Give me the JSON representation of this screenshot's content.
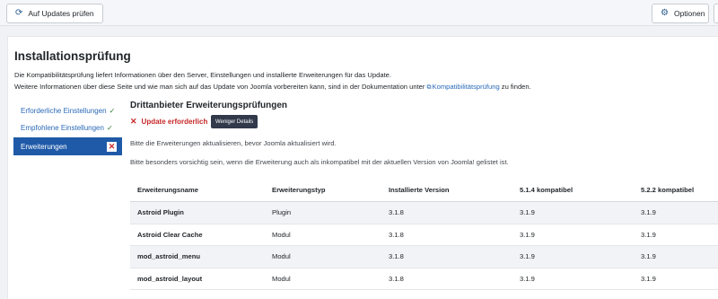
{
  "toolbar": {
    "updates_label": "Auf Updates prüfen",
    "options_label": "Optionen",
    "updates_icon": "refresh-icon",
    "options_icon": "gear-icon"
  },
  "page": {
    "title": "Installationsprüfung",
    "intro_line1": "Die Kompatibilitätsprüfung liefert Informationen über den Server, Einstellungen und installierte Erweiterungen für das Update.",
    "intro_line2_before": "Weitere Informationen über diese Seite und wie man sich auf das Update von Joomla vorbereiten kann, sind in der Dokumentation unter ",
    "intro_link": "Kompatibilitätsprüfung",
    "intro_line2_after": " zu finden."
  },
  "nav": {
    "items": [
      {
        "label": "Erforderliche Einstellungen",
        "mark": "✓"
      },
      {
        "label": "Empfohlene Einstellungen",
        "mark": "✓"
      },
      {
        "label": "Erweiterungen",
        "mark": "✕"
      }
    ]
  },
  "section": {
    "title": "Drittanbieter Erweiterungsprüfungen",
    "status": "Update erforderlich",
    "details_button": "Weniger Details",
    "hint1": "Bitte die Erweiterungen aktualisieren, bevor Joomla aktualisiert wird.",
    "hint2": "Bitte besonders vorsichtig sein, wenn die Erweiterung auch als inkompatibel mit der aktuellen Version von Joomla! gelistet ist."
  },
  "table": {
    "headers": [
      "Erweiterungsname",
      "Erweiterungstyp",
      "Installierte Version",
      "5.1.4 kompatibel",
      "5.2.2 kompatibel"
    ],
    "rows": [
      [
        "Astroid Plugin",
        "Plugin",
        "3.1.8",
        "3.1.9",
        "3.1.9"
      ],
      [
        "Astroid Clear Cache",
        "Modul",
        "3.1.8",
        "3.1.9",
        "3.1.9"
      ],
      [
        "mod_astroid_menu",
        "Modul",
        "3.1.8",
        "3.1.9",
        "3.1.9"
      ],
      [
        "mod_astroid_layout",
        "Modul",
        "3.1.8",
        "3.1.9",
        "3.1.9"
      ]
    ]
  },
  "colors": {
    "accent": "#1f5aa8",
    "link": "#2a69b8",
    "error": "#c52827",
    "ok": "#2f7d32"
  }
}
